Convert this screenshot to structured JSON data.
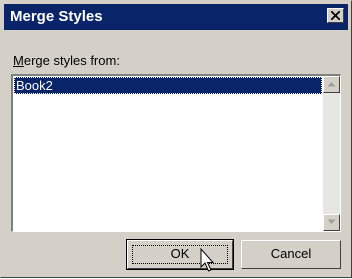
{
  "window": {
    "title": "Merge Styles",
    "close_icon": "close-icon"
  },
  "merge_from": {
    "label_prefix": "",
    "label_accel": "M",
    "label_rest": "erge styles from:",
    "items": [
      {
        "label": "Book2",
        "selected": true
      }
    ]
  },
  "buttons": {
    "ok_label": "OK",
    "cancel_label": "Cancel"
  },
  "colors": {
    "titlebar": "#0a246a",
    "face": "#d4d0c8",
    "selection": "#0a246a"
  }
}
